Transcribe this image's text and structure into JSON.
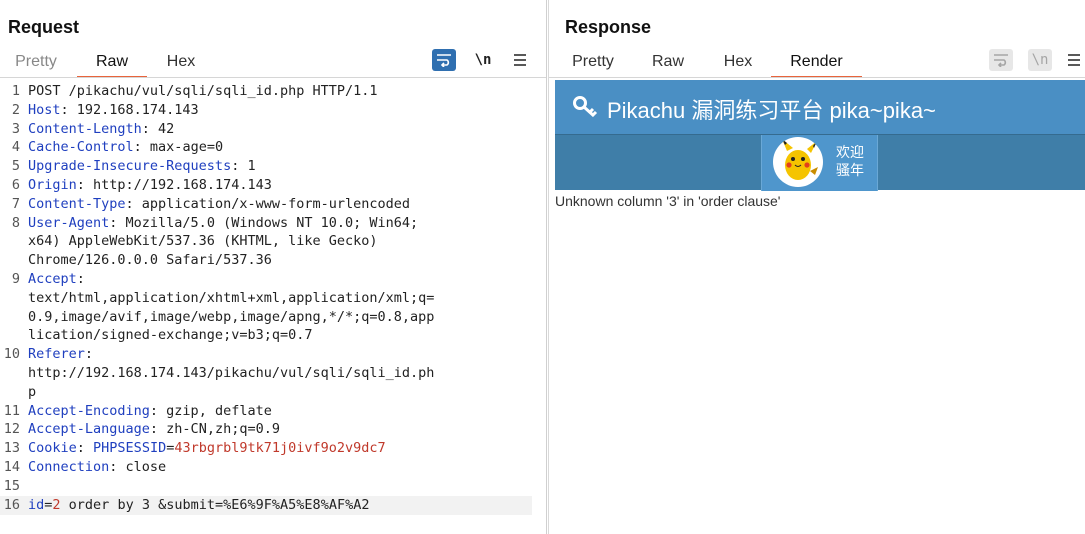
{
  "request": {
    "title": "Request",
    "tabs": [
      {
        "label": "Pretty",
        "active": false
      },
      {
        "label": "Raw",
        "active": true
      },
      {
        "label": "Hex",
        "active": false
      }
    ],
    "tools": {
      "wrap_icon": "wrap-lines-icon",
      "newline_label": "\\n",
      "menu_icon": "hamburger-menu-icon"
    },
    "line_numbers": [
      "1",
      "2",
      "3",
      "4",
      "5",
      "6",
      "7",
      "8",
      "",
      "",
      "9",
      "",
      "",
      "",
      "10",
      "",
      "",
      "11",
      "12",
      "13",
      "14",
      "15",
      "16"
    ],
    "lines": [
      {
        "parts": [
          {
            "t": "POST /pikachu/vul/sqli/sqli_id.php HTTP/1.1",
            "c": "v"
          }
        ]
      },
      {
        "parts": [
          {
            "t": "Host",
            "c": "k"
          },
          {
            "t": ": 192.168.174.143",
            "c": "v"
          }
        ]
      },
      {
        "parts": [
          {
            "t": "Content-Length",
            "c": "k"
          },
          {
            "t": ": 42",
            "c": "v"
          }
        ]
      },
      {
        "parts": [
          {
            "t": "Cache-Control",
            "c": "k"
          },
          {
            "t": ": max-age=0",
            "c": "v"
          }
        ]
      },
      {
        "parts": [
          {
            "t": "Upgrade-Insecure-Requests",
            "c": "k"
          },
          {
            "t": ": 1",
            "c": "v"
          }
        ]
      },
      {
        "parts": [
          {
            "t": "Origin",
            "c": "k"
          },
          {
            "t": ": http://192.168.174.143",
            "c": "v"
          }
        ]
      },
      {
        "parts": [
          {
            "t": "Content-Type",
            "c": "k"
          },
          {
            "t": ": application/x-www-form-urlencoded",
            "c": "v"
          }
        ]
      },
      {
        "parts": [
          {
            "t": "User-Agent",
            "c": "k"
          },
          {
            "t": ": Mozilla/5.0 (Windows NT 10.0; Win64;",
            "c": "v"
          }
        ]
      },
      {
        "parts": [
          {
            "t": "x64) AppleWebKit/537.36 (KHTML, like Gecko)",
            "c": "v"
          }
        ]
      },
      {
        "parts": [
          {
            "t": "Chrome/126.0.0.0 Safari/537.36",
            "c": "v"
          }
        ]
      },
      {
        "parts": [
          {
            "t": "Accept",
            "c": "k"
          },
          {
            "t": ":",
            "c": "v"
          }
        ]
      },
      {
        "parts": [
          {
            "t": "text/html,application/xhtml+xml,application/xml;q=",
            "c": "v"
          }
        ]
      },
      {
        "parts": [
          {
            "t": "0.9,image/avif,image/webp,image/apng,*/*;q=0.8,app",
            "c": "v"
          }
        ]
      },
      {
        "parts": [
          {
            "t": "lication/signed-exchange;v=b3;q=0.7",
            "c": "v"
          }
        ]
      },
      {
        "parts": [
          {
            "t": "Referer",
            "c": "k"
          },
          {
            "t": ":",
            "c": "v"
          }
        ]
      },
      {
        "parts": [
          {
            "t": "http://192.168.174.143/pikachu/vul/sqli/sqli_id.ph",
            "c": "v"
          }
        ]
      },
      {
        "parts": [
          {
            "t": "p",
            "c": "v"
          }
        ]
      },
      {
        "parts": [
          {
            "t": "Accept-Encoding",
            "c": "k"
          },
          {
            "t": ": gzip, deflate",
            "c": "v"
          }
        ]
      },
      {
        "parts": [
          {
            "t": "Accept-Language",
            "c": "k"
          },
          {
            "t": ": zh-CN,zh;q=0.9",
            "c": "v"
          }
        ]
      },
      {
        "parts": [
          {
            "t": "Cookie",
            "c": "ck"
          },
          {
            "t": ": ",
            "c": "v"
          },
          {
            "t": "PHPSESSID",
            "c": "ck"
          },
          {
            "t": "=",
            "c": "v"
          },
          {
            "t": "43rbgrbl9tk71j0ivf9o2v9dc7",
            "c": "cv"
          }
        ]
      },
      {
        "parts": [
          {
            "t": "Connection",
            "c": "k"
          },
          {
            "t": ": close",
            "c": "v"
          }
        ]
      },
      {
        "parts": [
          {
            "t": "",
            "c": "v"
          }
        ]
      },
      {
        "parts": [
          {
            "t": "id",
            "c": "pk"
          },
          {
            "t": "=",
            "c": "v"
          },
          {
            "t": "2",
            "c": "pv"
          },
          {
            "t": " order by 3 ",
            "c": "v"
          },
          {
            "t": "&",
            "c": "v"
          },
          {
            "t": "submit",
            "c": "v"
          },
          {
            "t": "=",
            "c": "v"
          },
          {
            "t": "%E6%9F%A5%E8%AF%A2",
            "c": "v"
          }
        ]
      }
    ]
  },
  "response": {
    "title": "Response",
    "tabs": [
      {
        "label": "Pretty",
        "active": false
      },
      {
        "label": "Raw",
        "active": false
      },
      {
        "label": "Hex",
        "active": false
      },
      {
        "label": "Render",
        "active": true
      }
    ],
    "tools": {
      "wrap_icon": "wrap-lines-icon",
      "newline_label": "\\n",
      "menu_icon": "hamburger-menu-icon"
    },
    "render": {
      "site_title": "Pikachu 漏洞练习平台 pika~pika~",
      "welcome_line1": "欢迎",
      "welcome_line2": "骚年",
      "error_message": "Unknown column '3' in 'order clause'"
    }
  },
  "layout_switcher": {
    "options": [
      "side-by-side",
      "stacked-horizontal",
      "stacked-single"
    ],
    "active": "side-by-side"
  },
  "colors": {
    "accent": "#2f6fb0",
    "active_tab_underline": "#e8643c",
    "key_blue": "#1f3fbf",
    "value_red": "#c0392b",
    "pikachu_header": "#4a8fc4"
  }
}
